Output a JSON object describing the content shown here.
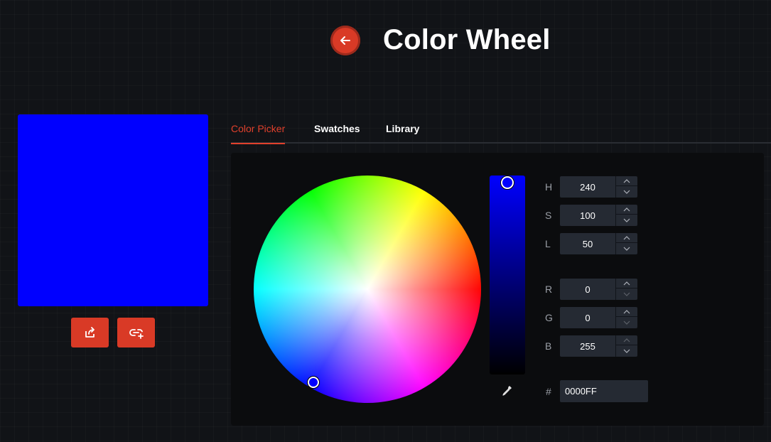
{
  "header": {
    "title": "Color Wheel",
    "back_icon": "arrow-left-icon"
  },
  "preview": {
    "color": "#0000FF"
  },
  "actions": [
    {
      "icon": "share-icon"
    },
    {
      "icon": "link-add-icon"
    }
  ],
  "tabs": [
    {
      "label": "Color Picker",
      "active": true
    },
    {
      "label": "Swatches",
      "active": false
    },
    {
      "label": "Library",
      "active": false
    }
  ],
  "picker": {
    "lightness_fraction": 0.5,
    "eyedropper_icon": "eyedropper-icon"
  },
  "fields": {
    "h": {
      "label": "H",
      "value": "240"
    },
    "s": {
      "label": "S",
      "value": "100"
    },
    "l": {
      "label": "L",
      "value": "50"
    },
    "r": {
      "label": "R",
      "value": "0"
    },
    "g": {
      "label": "G",
      "value": "0"
    },
    "b": {
      "label": "B",
      "value": "255"
    }
  },
  "hex": {
    "label": "#",
    "value": "0000FF"
  },
  "colors": {
    "accent": "#D93A26",
    "active_tab": "#E0402C",
    "selected": "#0000FF"
  }
}
